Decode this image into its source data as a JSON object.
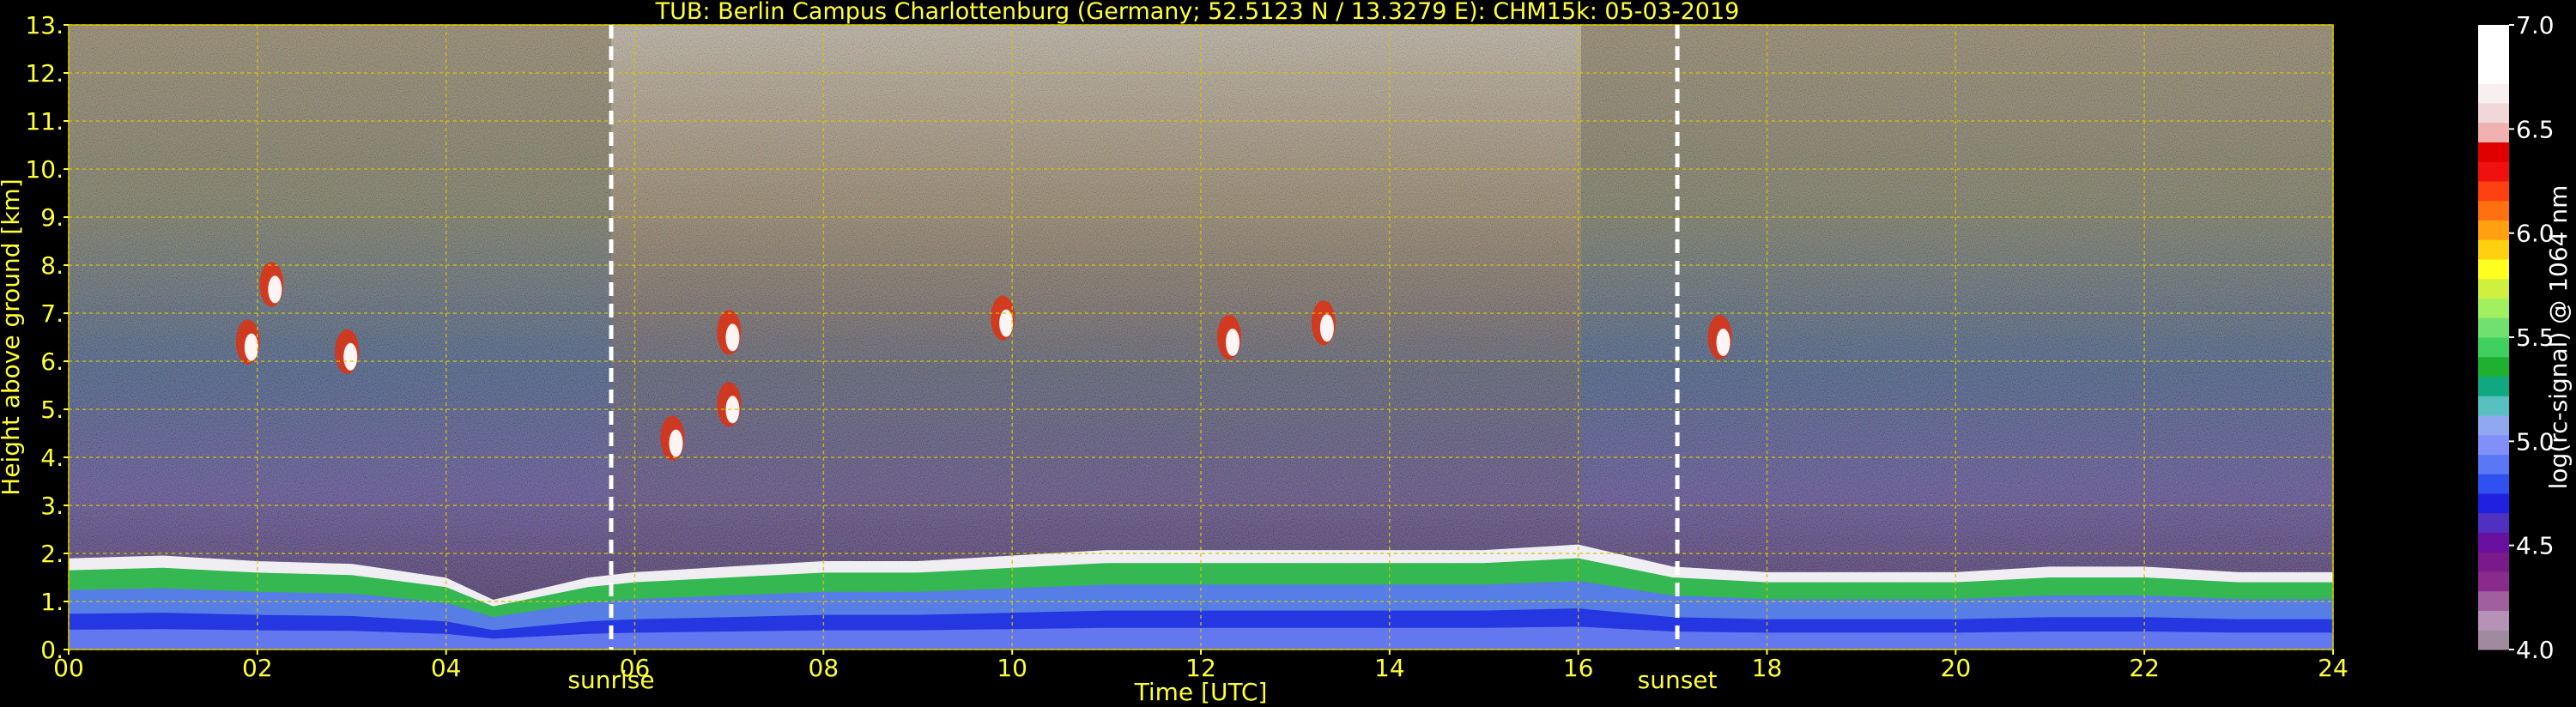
{
  "chart_data": {
    "type": "heatmap",
    "title": "TUB: Berlin Campus Charlottenburg (Germany; 52.5123 N / 13.3279 E):    CHM15k: 05-03-2019",
    "xlabel": "Time [UTC]",
    "ylabel": "Height above ground [km]",
    "xlim": [
      0,
      24
    ],
    "ylim": [
      0,
      13
    ],
    "x_ticks": [
      "00",
      "02",
      "04",
      "06",
      "08",
      "10",
      "12",
      "14",
      "16",
      "18",
      "20",
      "22",
      "24"
    ],
    "y_ticks": [
      "0.",
      "1.",
      "2.",
      "3.",
      "4.",
      "5.",
      "6.",
      "7.",
      "8.",
      "9.",
      "10.",
      "11.",
      "12.",
      "13."
    ],
    "grid": true,
    "markers": [
      {
        "label": "sunrise",
        "x": 5.75
      },
      {
        "label": "sunset",
        "x": 17.05
      }
    ],
    "boundary_layer_top_km": [
      [
        0,
        1.65
      ],
      [
        1,
        1.7
      ],
      [
        2,
        1.6
      ],
      [
        3,
        1.55
      ],
      [
        4,
        1.3
      ],
      [
        4.5,
        0.9
      ],
      [
        5,
        1.1
      ],
      [
        5.5,
        1.3
      ],
      [
        6,
        1.4
      ],
      [
        7,
        1.5
      ],
      [
        8,
        1.6
      ],
      [
        9,
        1.6
      ],
      [
        10,
        1.7
      ],
      [
        11,
        1.8
      ],
      [
        12,
        1.8
      ],
      [
        13,
        1.8
      ],
      [
        14,
        1.8
      ],
      [
        15,
        1.8
      ],
      [
        16,
        1.9
      ],
      [
        17,
        1.5
      ],
      [
        18,
        1.4
      ],
      [
        19,
        1.4
      ],
      [
        20,
        1.4
      ],
      [
        21,
        1.5
      ],
      [
        22,
        1.5
      ],
      [
        23,
        1.4
      ],
      [
        24,
        1.4
      ]
    ],
    "cloud_features": [
      {
        "time": 1.9,
        "height_km": 6.4
      },
      {
        "time": 2.15,
        "height_km": 7.6
      },
      {
        "time": 2.95,
        "height_km": 6.2
      },
      {
        "time": 6.4,
        "height_km": 4.4
      },
      {
        "time": 7.0,
        "height_km": 5.1
      },
      {
        "time": 7.0,
        "height_km": 6.6
      },
      {
        "time": 9.9,
        "height_km": 6.9
      },
      {
        "time": 12.3,
        "height_km": 6.5
      },
      {
        "time": 13.3,
        "height_km": 6.8
      },
      {
        "time": 17.5,
        "height_km": 6.5
      }
    ],
    "colorbar": {
      "label": "log(rc-signal) @ 1064 nm",
      "range": [
        4.0,
        7.0
      ],
      "ticks": [
        "4.0",
        "4.5",
        "5.0",
        "5.5",
        "6.0",
        "6.5",
        "7.0"
      ],
      "colors": [
        "#a08aa0",
        "#b693b6",
        "#a060a0",
        "#8a2a8a",
        "#7a1a8a",
        "#6a10a0",
        "#5030c0",
        "#2020e0",
        "#3050f0",
        "#5a78f5",
        "#8090f8",
        "#90a8f0",
        "#58c0c0",
        "#10a880",
        "#20b030",
        "#40d060",
        "#70e070",
        "#a0f060",
        "#d0f040",
        "#ffff20",
        "#ffd010",
        "#ffa010",
        "#ff7010",
        "#ff4010",
        "#f01010",
        "#e00000",
        "#f0b0b0",
        "#f0d8d8",
        "#f8f0f0",
        "#ffffff",
        "#ffffff",
        "#ffffff"
      ]
    }
  }
}
